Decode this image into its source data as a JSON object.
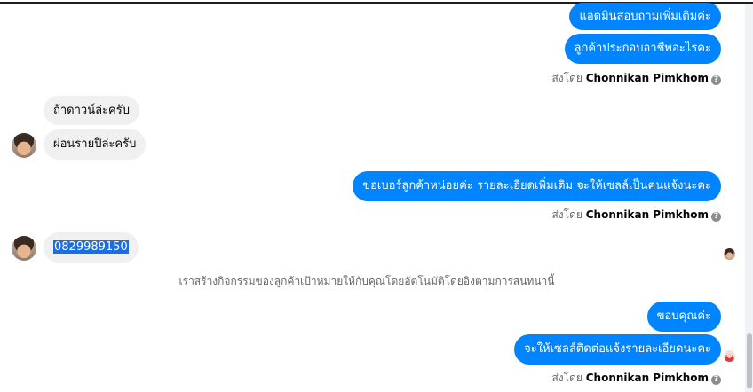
{
  "messages": {
    "m1": "แอดมินสอบถามเพิ่มเติมค่ะ",
    "m2": "ลูกค้าประกอบอาชีพอะไรคะ",
    "m3": "ถ้าดาวน์ล่ะครับ",
    "m4": "ผ่อนรายปีล่ะครับ",
    "m5": "ขอเบอร์ลูกค้าหน่อยค่ะ รายละเอียดเพิ่มเติม จะให้เซลล์เป็นคนแจ้งนะคะ",
    "m6": "0829989150",
    "m7": "ขอบคุณค่ะ",
    "m8": "จะให้เซลล์ติดต่อแจ้งรายละเอียดนะคะ"
  },
  "sent_by": {
    "prefix": "ส่งโดย",
    "name": "Chonnikan Pimkhom",
    "help_glyph": "?"
  },
  "system_message": "เราสร้างกิจกรรมของลูกค้าเป้าหมายให้กับคุณโดยอัตโนมัติโดยอิงตามการสนทนานี้",
  "colors": {
    "outgoing_bubble": "#0084ff",
    "incoming_bubble": "#f0f0f0",
    "phone_highlight": "#1a6ee0"
  },
  "icons": {
    "help": "question-circle-icon",
    "avatar": "customer-avatar",
    "seen": "seen-receipt-avatar"
  }
}
